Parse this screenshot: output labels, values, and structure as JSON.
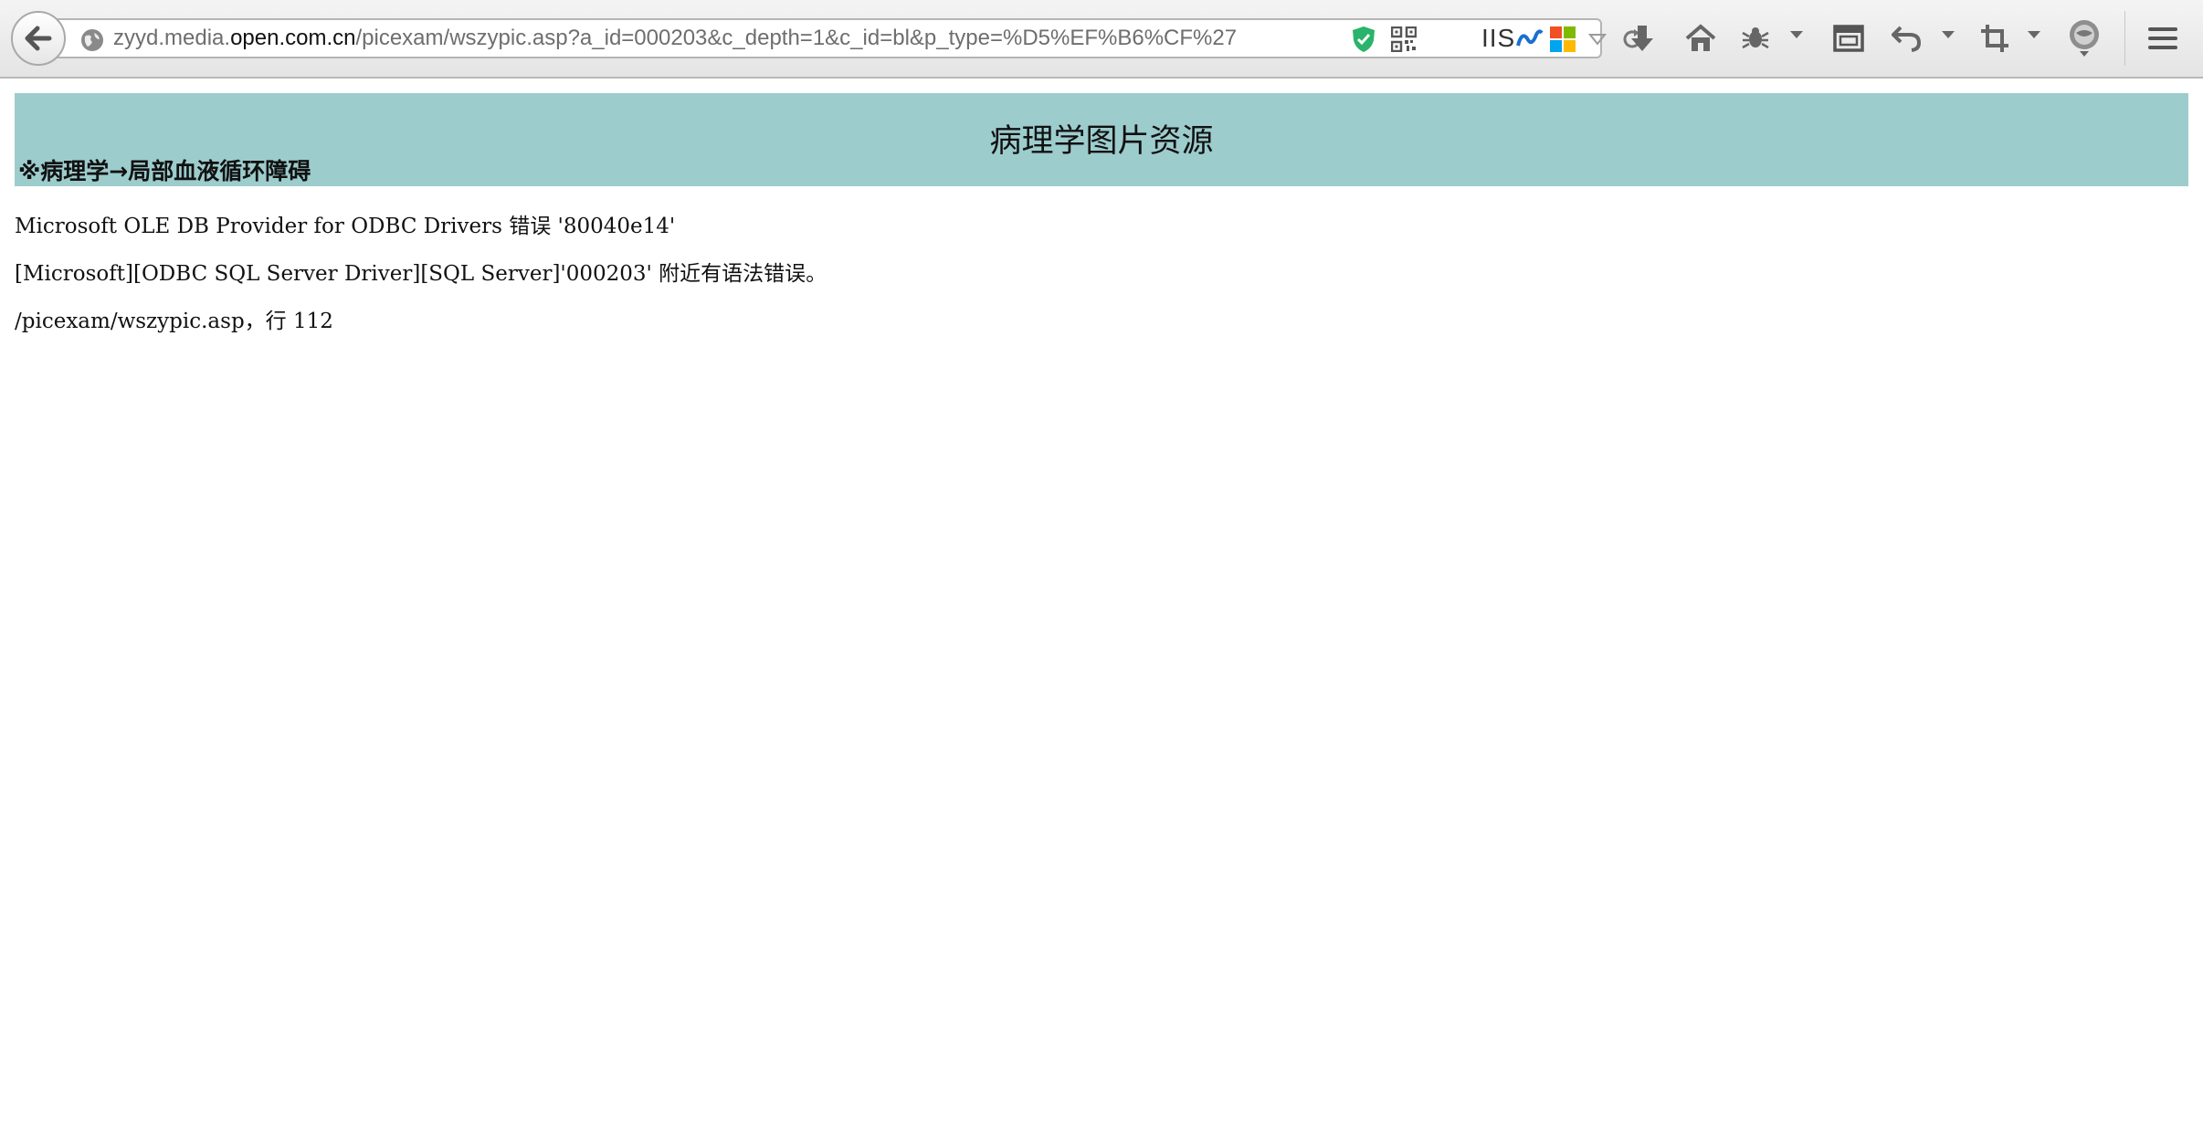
{
  "browser": {
    "url_prefix": "zyyd.media.",
    "url_domain": "open.com.cn",
    "url_path": "/picexam/wszypic.asp?a_id=000203&c_depth=1&c_id=bl&p_type=%D5%EF%B6%CF%27",
    "iis_label": "IIS",
    "icons": [
      "back-arrow-icon",
      "globe-icon",
      "shield-check-icon",
      "qr-code-icon",
      "net-icon",
      "windows-icon",
      "dropdown-icon",
      "reload-icon",
      "download-icon",
      "home-icon",
      "bug-icon",
      "window-icon",
      "undo-icon",
      "crop-icon",
      "sync-icon",
      "menu-icon"
    ]
  },
  "page": {
    "title": "病理学图片资源",
    "breadcrumb": "※病理学→局部血液循环障碍",
    "header_color": "#9dcccd"
  },
  "error": {
    "line1": "Microsoft OLE DB Provider for ODBC Drivers 错误 '80040e14'",
    "line2": "[Microsoft][ODBC SQL Server Driver][SQL Server]'000203' 附近有语法错误。",
    "line3": "/picexam/wszypic.asp，行 112"
  }
}
